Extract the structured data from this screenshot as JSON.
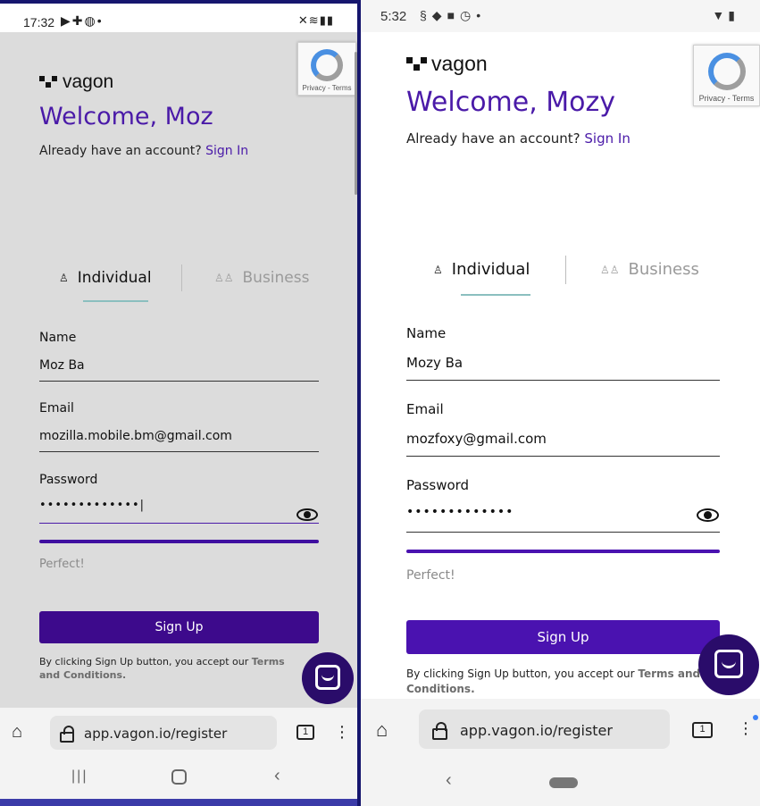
{
  "left": {
    "status": {
      "time": "17:32",
      "icons": [
        "youtube-icon",
        "puzzle-icon",
        "globe-icon",
        "dot-icon"
      ],
      "right_icons": [
        "mute-icon",
        "wifi-icon",
        "signal-icon",
        "battery-icon"
      ]
    },
    "recaptcha": {
      "text": "Privacy - Terms"
    },
    "logo": {
      "word": "vagon"
    },
    "welcome": "Welcome, Moz",
    "already_text": "Already have an account?",
    "sign_in": "Sign In",
    "tabs": {
      "individual": "Individual",
      "business": "Business"
    },
    "name_label": "Name",
    "name_value": "Moz Ba",
    "email_label": "Email",
    "email_value": "mozilla.mobile.bm@gmail.com",
    "password_label": "Password",
    "password_value": "•••••••••••••|",
    "strength_text": "Perfect!",
    "signup_label": "Sign Up",
    "terms_text": "By clicking Sign Up button, you accept our",
    "terms_link_1": "Terms",
    "terms_link_2": "and Conditions.",
    "url": "app.vagon.io/register",
    "tab_count": "1"
  },
  "right": {
    "status": {
      "time": "5:32",
      "icons": [
        "s-icon",
        "shield-icon",
        "square-icon",
        "clock-icon",
        "dot-icon"
      ],
      "right_icons": [
        "wifi-icon",
        "battery-icon"
      ]
    },
    "recaptcha": {
      "text": "Privacy - Terms"
    },
    "logo": {
      "word": "vagon"
    },
    "welcome": "Welcome, Mozy",
    "already_text": "Already have an account?",
    "sign_in": "Sign In",
    "tabs": {
      "individual": "Individual",
      "business": "Business"
    },
    "name_label": "Name",
    "name_value": "Mozy Ba",
    "email_label": "Email",
    "email_value": "mozfoxy@gmail.com",
    "password_label": "Password",
    "password_value": "•••••••••••••",
    "strength_text": "Perfect!",
    "signup_label": "Sign Up",
    "terms_text": "By clicking Sign Up button, you accept our",
    "terms_link_1": "Terms and",
    "terms_link_2": "Conditions.",
    "url": "app.vagon.io/register",
    "tab_count": "1"
  },
  "colors": {
    "brand_purple": "#4a1aa8",
    "button_purple": "#3d0a8c",
    "tab_underline": "#8bbfbf"
  }
}
